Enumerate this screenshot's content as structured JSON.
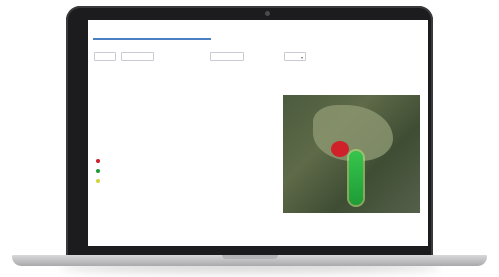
{
  "colors": {
    "laptop_bezel": "#1c1c1e",
    "accent": "#4a7fc1",
    "status_red": "#d0202a",
    "status_green": "#1f9c36",
    "status_yellow": "#d6d23a"
  },
  "app": {
    "breadcrumb": "",
    "title": "",
    "header_link": ""
  },
  "form": {
    "fields": [
      {
        "label": "",
        "value": ""
      },
      {
        "label": "",
        "value": ""
      },
      {
        "label": "",
        "value": ""
      },
      {
        "label": "",
        "value": ""
      }
    ],
    "links": [
      "",
      "",
      ""
    ]
  },
  "summary": {
    "primary_value": "",
    "primary_caption": "",
    "secondary_value": "",
    "secondary_caption": "",
    "stats": [
      {
        "value": "",
        "caption": ""
      },
      {
        "value": "",
        "caption": ""
      },
      {
        "value": "",
        "caption": ""
      },
      {
        "value": "",
        "caption": ""
      }
    ]
  },
  "table": {
    "headers": [
      "",
      "",
      "",
      ""
    ],
    "rows": [
      {
        "status": "red",
        "cells": [
          "",
          "",
          "",
          ""
        ]
      },
      {
        "status": "green",
        "cells": [
          "",
          "",
          "",
          ""
        ]
      },
      {
        "status": "yellow",
        "cells": [
          "",
          "",
          "",
          ""
        ]
      }
    ]
  },
  "map": {
    "icon": "satellite-map"
  }
}
